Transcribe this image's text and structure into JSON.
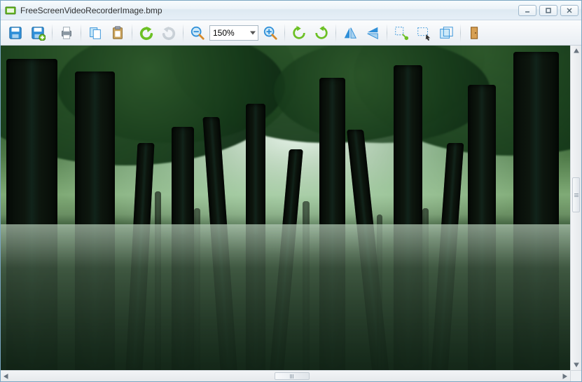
{
  "window": {
    "title": "FreeScreenVideoRecorderImage.bmp"
  },
  "controls": {
    "minimize": "minimize",
    "maximize": "maximize",
    "close": "close"
  },
  "toolbar": {
    "save": "Save",
    "save_as": "Save As",
    "print": "Print",
    "copy": "Copy",
    "paste": "Paste",
    "undo": "Undo",
    "redo": "Redo",
    "zoom_out": "Zoom Out",
    "zoom_value": "150%",
    "zoom_in": "Zoom In",
    "rotate_left": "Rotate Left",
    "rotate_right": "Rotate Right",
    "flip_h": "Flip Horizontal",
    "flip_v": "Flip Vertical",
    "resize": "Resize",
    "select": "Select",
    "crop": "Crop",
    "exit": "Exit"
  },
  "colors": {
    "accent_blue": "#2f8fd8",
    "accent_green": "#6cc024",
    "accent_orange": "#d78a2a",
    "window_border": "#7aa6c2"
  }
}
